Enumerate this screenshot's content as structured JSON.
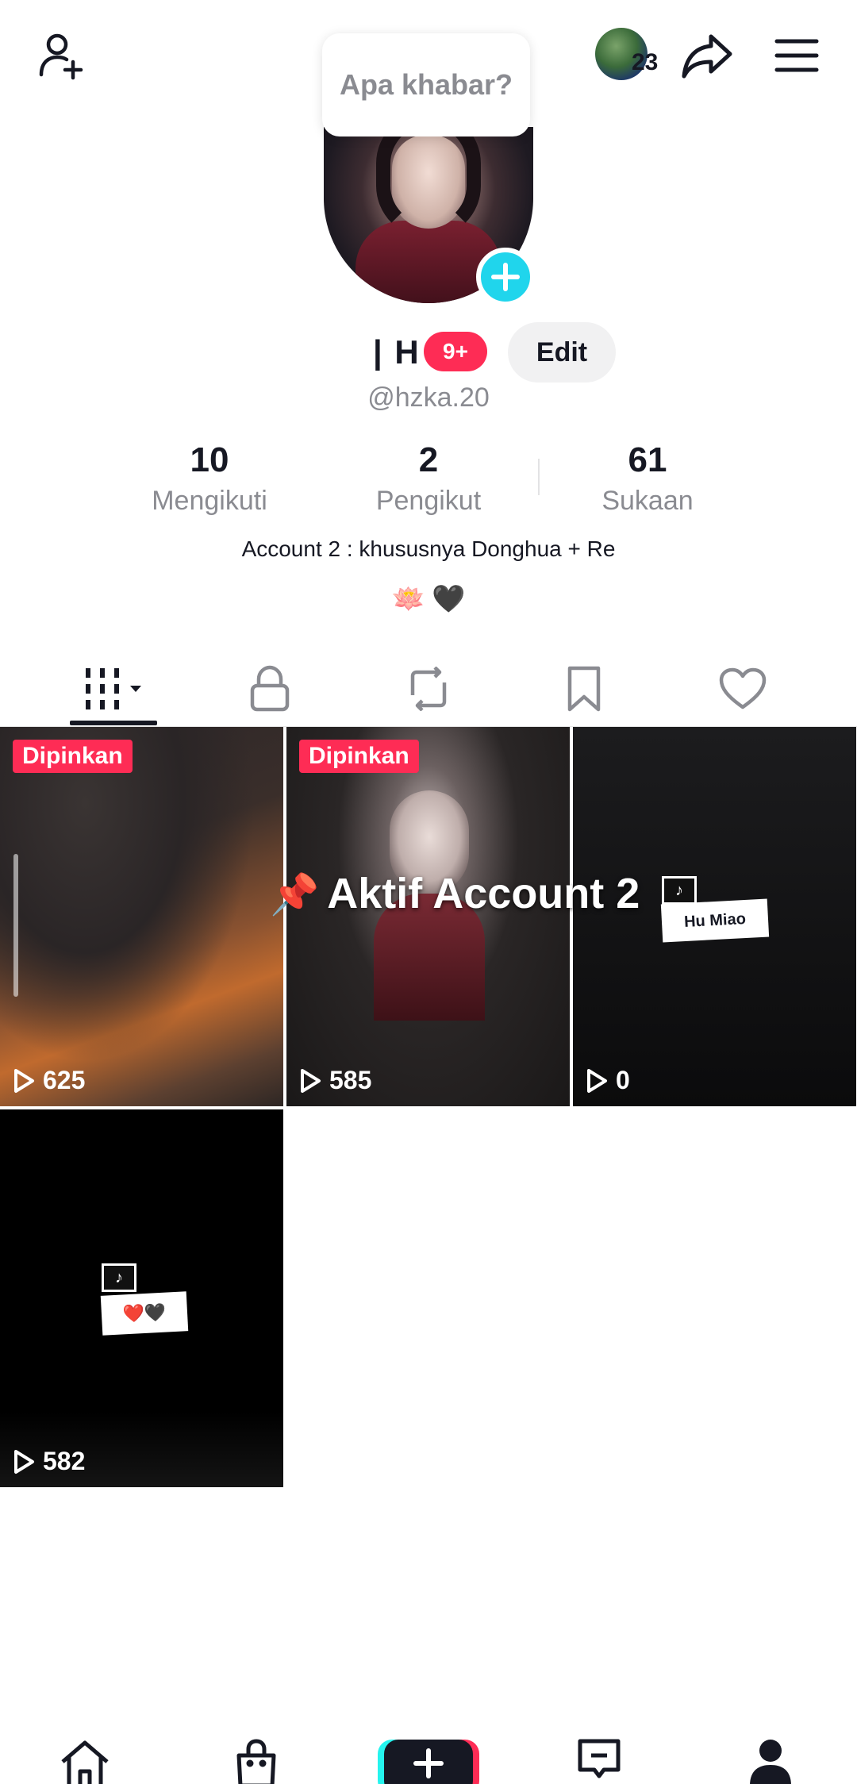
{
  "header": {
    "add_friend_icon": "person-plus-icon",
    "story_count": "23",
    "share_icon": "share-arrow-icon",
    "menu_icon": "hamburger-menu-icon"
  },
  "bubble": {
    "text": "Apa khabar?"
  },
  "profile": {
    "name": "| H",
    "notification_badge": "9+",
    "edit_label": "Edit",
    "handle": "@hzka.20",
    "bio": "Account 2 : khususnya Donghua + Re",
    "bio_emojis": [
      "🪷",
      "🖤"
    ]
  },
  "stats": [
    {
      "value": "10",
      "label": "Mengikuti"
    },
    {
      "value": "2",
      "label": "Pengikut"
    },
    {
      "value": "61",
      "label": "Sukaan"
    }
  ],
  "tabs": [
    {
      "icon": "grid-videos-icon",
      "active": true
    },
    {
      "icon": "lock-icon",
      "active": false
    },
    {
      "icon": "repost-icon",
      "active": false
    },
    {
      "icon": "bookmark-icon",
      "active": false
    },
    {
      "icon": "heart-icon",
      "active": false
    }
  ],
  "videos": [
    {
      "pinned_label": "Dipinkan",
      "views": "625"
    },
    {
      "pinned_label": "Dipinkan",
      "views": "585",
      "overlay_text": "Aktif Account 2"
    },
    {
      "views": "0",
      "sticker_text": "Hu Miao"
    },
    {
      "views": "582",
      "sticker_emojis": "❤️🖤"
    }
  ],
  "bottom_nav": [
    {
      "icon": "home-icon"
    },
    {
      "icon": "shop-bag-icon"
    },
    {
      "icon": "create-plus-icon"
    },
    {
      "icon": "inbox-icon"
    },
    {
      "icon": "profile-icon"
    }
  ],
  "colors": {
    "accent_red": "#fe2c55",
    "accent_cyan": "#25f4ee",
    "plus_badge": "#20d5ec",
    "text_primary": "#161823",
    "text_secondary": "#8a8b91"
  }
}
